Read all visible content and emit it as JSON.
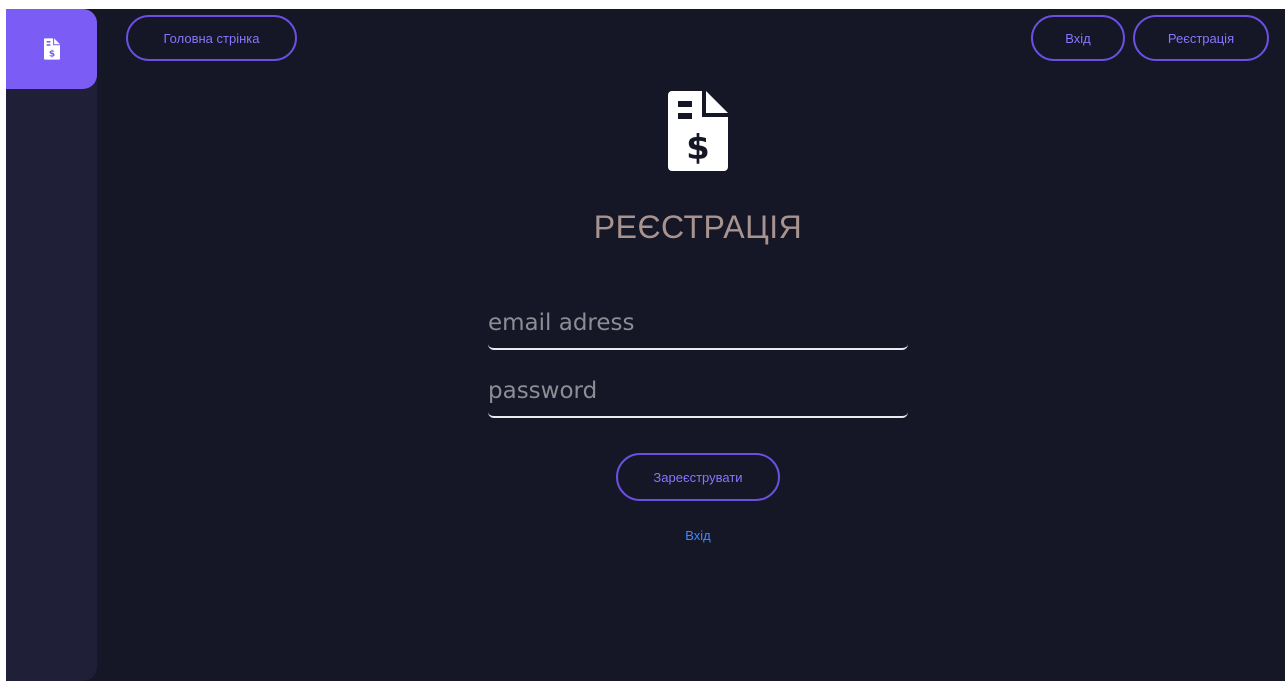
{
  "nav": {
    "home_label": "Головна стрінка",
    "login_label": "Вхід",
    "register_label": "Реєстрація"
  },
  "form": {
    "title": "РЕЄСТРАЦІЯ",
    "email_placeholder": "email adress",
    "email_value": "",
    "password_placeholder": "password",
    "password_value": "",
    "submit_label": "Зареєструвати",
    "login_link": "Вхід"
  },
  "icons": {
    "sidebar_logo": "invoice-dollar-icon",
    "main_logo": "invoice-dollar-icon"
  },
  "colors": {
    "background": "#151626",
    "sidebar": "#1f2038",
    "accent": "#7b5cf5",
    "button_text": "#8c74ff",
    "title": "#a8938f",
    "link": "#3d8bff"
  }
}
